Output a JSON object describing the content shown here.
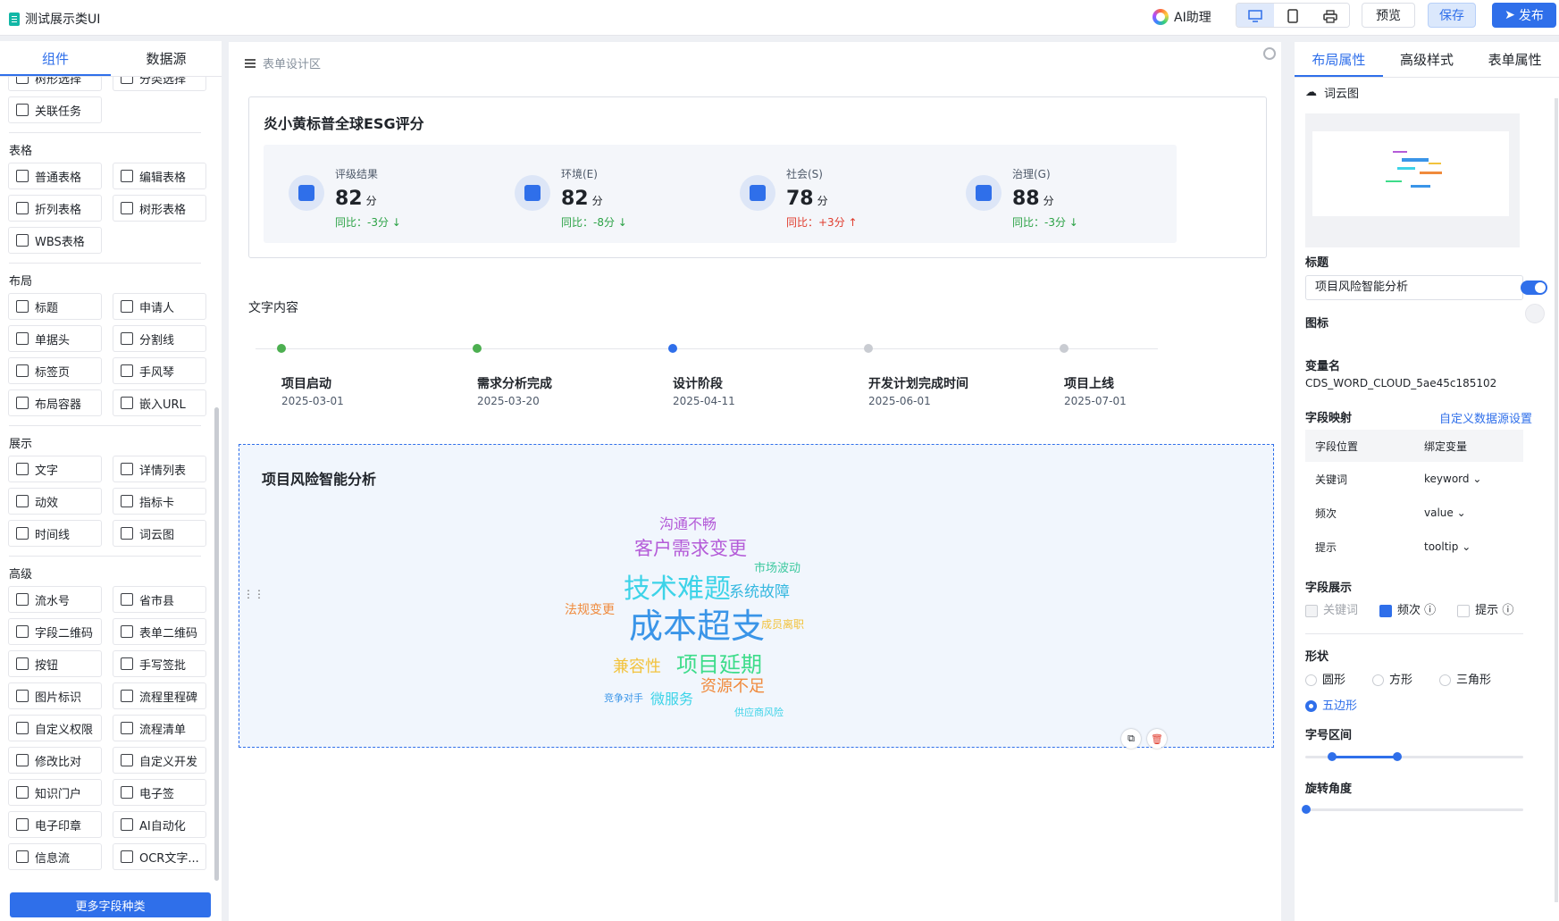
{
  "app": {
    "title": "测试展示类UI",
    "ai_label": "AI助理",
    "preview": "预览",
    "save": "保存",
    "publish": "发布"
  },
  "left": {
    "tabs": [
      "组件",
      "数据源"
    ],
    "top_items": [
      "树形选择",
      "分类选择",
      "关联任务"
    ],
    "sections": [
      {
        "title": "表格",
        "items": [
          "普通表格",
          "编辑表格",
          "折列表格",
          "树形表格",
          "WBS表格"
        ]
      },
      {
        "title": "布局",
        "items": [
          "标题",
          "申请人",
          "单据头",
          "分割线",
          "标签页",
          "手风琴",
          "布局容器",
          "嵌入URL"
        ]
      },
      {
        "title": "展示",
        "items": [
          "文字",
          "详情列表",
          "动效",
          "指标卡",
          "时间线",
          "词云图"
        ]
      },
      {
        "title": "高级",
        "items": [
          "流水号",
          "省市县",
          "字段二维码",
          "表单二维码",
          "按钮",
          "手写签批",
          "图片标识",
          "流程里程碑",
          "自定义权限",
          "流程清单",
          "修改比对",
          "自定义开发",
          "知识门户",
          "电子签",
          "电子印章",
          "AI自动化",
          "信息流",
          "OCR文字..."
        ]
      }
    ],
    "more_button": "更多字段种类"
  },
  "center": {
    "header": "表单设计区",
    "esg": {
      "title": "炎小黄标普全球ESG评分",
      "cards": [
        {
          "label": "评级结果",
          "value": "82",
          "unit": "分",
          "compare": "同比：-3分",
          "trend": "down"
        },
        {
          "label": "环境(E)",
          "value": "82",
          "unit": "分",
          "compare": "同比：-8分",
          "trend": "down"
        },
        {
          "label": "社会(S)",
          "value": "78",
          "unit": "分",
          "compare": "同比：+3分",
          "trend": "up"
        },
        {
          "label": "治理(G)",
          "value": "88",
          "unit": "分",
          "compare": "同比：-3分",
          "trend": "down"
        }
      ]
    },
    "text_section": "文字内容",
    "timeline": [
      {
        "label": "项目启动",
        "date": "2025-03-01",
        "status": "done"
      },
      {
        "label": "需求分析完成",
        "date": "2025-03-20",
        "status": "done"
      },
      {
        "label": "设计阶段",
        "date": "2025-04-11",
        "status": "current"
      },
      {
        "label": "开发计划完成时间",
        "date": "2025-06-01",
        "status": "pending"
      },
      {
        "label": "项目上线",
        "date": "2025-07-01",
        "status": "pending"
      }
    ],
    "wordcloud": {
      "title": "项目风险智能分析",
      "words": [
        "沟通不畅",
        "客户需求变更",
        "市场波动",
        "技术难题",
        "系统故障",
        "法规变更",
        "成本超支",
        "成员离职",
        "兼容性",
        "项目延期",
        "资源不足",
        "竞争对手",
        "微服务",
        "供应商风险"
      ]
    }
  },
  "right": {
    "tabs": [
      "布局属性",
      "高级样式",
      "表单属性"
    ],
    "component": "词云图",
    "title_label": "标题",
    "title_value": "项目风险智能分析",
    "icon_label": "图标",
    "var_label": "变量名",
    "var_value": "CDS_WORD_CLOUD_5ae45c185102",
    "mapping_label": "字段映射",
    "mapping_link": "自定义数据源设置",
    "mapping_head": [
      "字段位置",
      "绑定变量"
    ],
    "mapping_rows": [
      {
        "field": "关键词",
        "var": "keyword"
      },
      {
        "field": "频次",
        "var": "value"
      },
      {
        "field": "提示",
        "var": "tooltip"
      }
    ],
    "display_label": "字段展示",
    "display_opts": [
      "关键词",
      "频次",
      "提示"
    ],
    "shape_label": "形状",
    "shapes": [
      "圆形",
      "方形",
      "三角形",
      "五边形"
    ],
    "font_range_label": "字号区间",
    "rotate_label": "旋转角度"
  }
}
